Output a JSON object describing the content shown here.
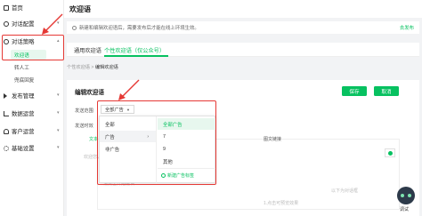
{
  "sidebar": {
    "items": [
      {
        "label": "首页",
        "icon": "home-icon"
      },
      {
        "label": "对话配置",
        "icon": "chat-icon"
      },
      {
        "label": "对话策略",
        "icon": "strategy-icon"
      },
      {
        "label": "发布管理",
        "icon": "send-icon"
      },
      {
        "label": "数据运营",
        "icon": "data-icon"
      },
      {
        "label": "客户运营",
        "icon": "user-icon"
      },
      {
        "label": "基础设置",
        "icon": "gear-icon"
      }
    ],
    "sub_items": [
      "欢迎语",
      "转人工",
      "兜底回复"
    ]
  },
  "header": {
    "title": "欢迎语"
  },
  "notice": {
    "text": "新建和编辑欢迎语后，需要发布后才能在线上环境生效。",
    "link": "去发布"
  },
  "tabs": [
    {
      "label": "通用欢迎语"
    },
    {
      "label": "个性欢迎语（仅公众号）"
    }
  ],
  "breadcrumb": {
    "parent": "个性欢迎语",
    "sep": ">",
    "current": "编辑欢迎语"
  },
  "editor": {
    "title": "编辑欢迎语",
    "save_label": "保存",
    "cancel_label": "取消",
    "scope_label": "发送范围",
    "scope_value": "全部广告",
    "time_label": "发送时效",
    "text_tab": "文本",
    "image_tab": "图文链接",
    "placeholder": "欢迎您，请输入欢迎语",
    "hint": "请点击开始编辑",
    "footer": "1.点击可预览效果",
    "side_hint": "以下为对话框"
  },
  "dropdown": {
    "left": [
      {
        "label": "全部"
      },
      {
        "label": "广告"
      },
      {
        "label": "非广告"
      }
    ],
    "right": [
      {
        "label": "全部广告"
      },
      {
        "label": "7"
      },
      {
        "label": "9"
      },
      {
        "label": "其他"
      }
    ],
    "new_label": "新建广告标签"
  },
  "bot": {
    "label": "调试"
  },
  "colors": {
    "accent": "#07c160",
    "annotation": "#e53935"
  }
}
